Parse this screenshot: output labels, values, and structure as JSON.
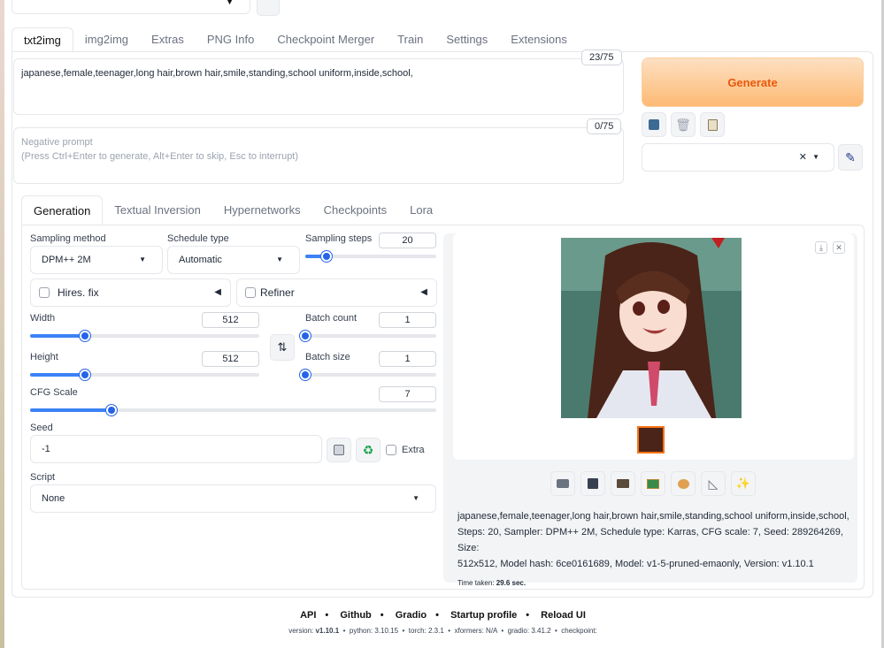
{
  "tabs": [
    "txt2img",
    "img2img",
    "Extras",
    "PNG Info",
    "Checkpoint Merger",
    "Train",
    "Settings",
    "Extensions"
  ],
  "prompt": {
    "value": "japanese,female,teenager,long hair,brown hair,smile,standing,school uniform,inside,school,",
    "counter": "23/75"
  },
  "negative": {
    "placeholder_line1": "Negative prompt",
    "placeholder_line2": "(Press Ctrl+Enter to generate, Alt+Enter to skip, Esc to interrupt)",
    "counter": "0/75"
  },
  "generate_label": "Generate",
  "subtabs": [
    "Generation",
    "Textual Inversion",
    "Hypernetworks",
    "Checkpoints",
    "Lora"
  ],
  "sampling": {
    "method_label": "Sampling method",
    "method_value": "DPM++ 2M",
    "schedule_label": "Schedule type",
    "schedule_value": "Automatic",
    "steps_label": "Sampling steps",
    "steps_value": "20",
    "steps_fraction": 0.16
  },
  "hires_label": "Hires. fix",
  "refiner_label": "Refiner",
  "width": {
    "label": "Width",
    "value": "512",
    "fraction": 0.24
  },
  "height": {
    "label": "Height",
    "value": "512",
    "fraction": 0.24
  },
  "batch_count": {
    "label": "Batch count",
    "value": "1",
    "fraction": 0.0
  },
  "batch_size": {
    "label": "Batch size",
    "value": "1",
    "fraction": 0.0
  },
  "cfg": {
    "label": "CFG Scale",
    "value": "7",
    "fraction": 0.2
  },
  "seed": {
    "label": "Seed",
    "value": "-1",
    "extra_label": "Extra"
  },
  "script": {
    "label": "Script",
    "value": "None"
  },
  "info": {
    "line1": "japanese,female,teenager,long hair,brown hair,smile,standing,school uniform,inside,school,",
    "line2": "Steps: 20, Sampler: DPM++ 2M, Schedule type: Karras, CFG scale: 7, Seed: 289264269, Size:",
    "line3": "512x512, Model hash: 6ce0161689, Model: v1-5-pruned-emaonly, Version: v1.10.1",
    "time_label": "Time taken:",
    "time_value": "29.6 sec."
  },
  "footer": {
    "links": [
      "API",
      "Github",
      "Gradio",
      "Startup profile",
      "Reload UI"
    ],
    "version_label": "version:",
    "version": "v1.10.1",
    "python_label": "python: 3.10.15",
    "torch_label": "torch: 2.3.1",
    "xformers_label": "xformers: N/A",
    "gradio_label": "gradio: 3.41.2",
    "checkpoint_label": "checkpoint:"
  },
  "colors": {
    "accent": "#2563eb",
    "generate": "#ea580c"
  },
  "icons": [
    "refresh-icon",
    "paste-icon",
    "trash-icon",
    "clipboard-icon",
    "edit-icon",
    "swap-icon",
    "dice-icon",
    "recycle-icon",
    "folder-icon",
    "save-icon",
    "zip-icon",
    "image-icon",
    "palette-icon",
    "ruler-icon",
    "sparkle-icon",
    "download-icon",
    "close-icon"
  ]
}
